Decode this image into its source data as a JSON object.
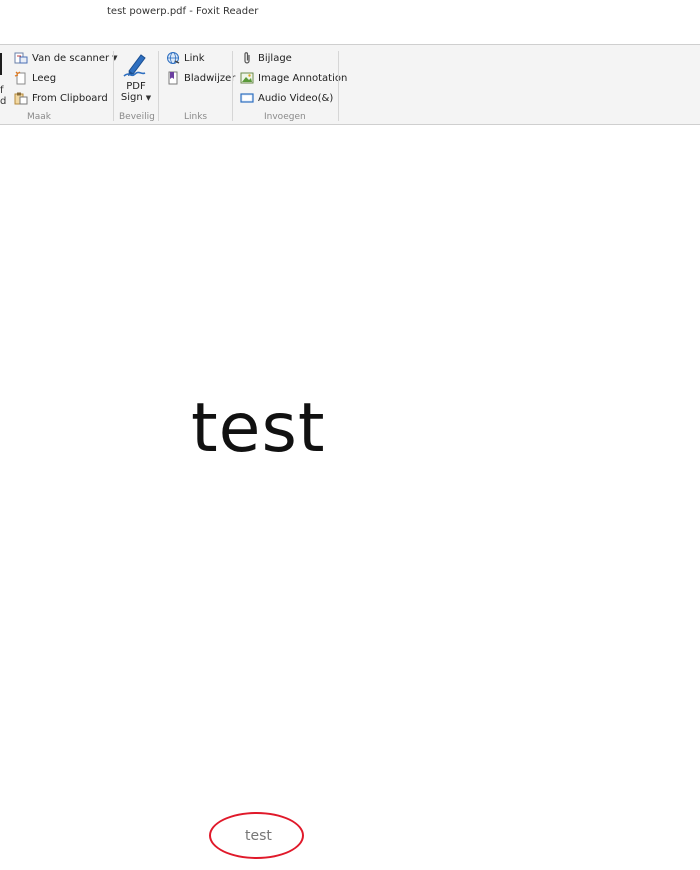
{
  "window": {
    "title": "test powerp.pdf - Foxit Reader"
  },
  "ribbon": {
    "partial_left": {
      "label_line1": "f",
      "label_line2": "d"
    },
    "maak": {
      "label": "Maak",
      "items": [
        {
          "label": "Van de scanner",
          "icon": "scanner-icon",
          "has_dropdown": true
        },
        {
          "label": "Leeg",
          "icon": "blank-page-icon"
        },
        {
          "label": "From Clipboard",
          "icon": "clipboard-icon"
        }
      ]
    },
    "beveilig": {
      "label": "Beveilig",
      "pdf_sign": {
        "line1": "PDF",
        "line2": "Sign",
        "icon": "pen-sign-icon",
        "has_dropdown": true
      }
    },
    "links": {
      "label": "Links",
      "items": [
        {
          "label": "Link",
          "icon": "globe-link-icon"
        },
        {
          "label": "Bladwijzer",
          "icon": "bookmark-icon"
        }
      ]
    },
    "invoegen": {
      "label": "Invoegen",
      "items": [
        {
          "label": "Bijlage",
          "icon": "paperclip-icon"
        },
        {
          "label": "Image Annotation",
          "icon": "image-icon"
        },
        {
          "label": "Audio  Video(&)",
          "icon": "video-icon"
        }
      ]
    }
  },
  "document": {
    "main_text": "test",
    "footer_text": "test",
    "annotation_color": "#e0192a"
  }
}
